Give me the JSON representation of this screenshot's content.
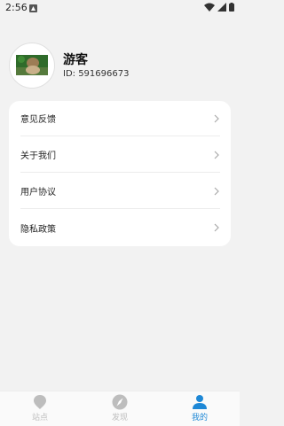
{
  "status_bar": {
    "time": "2:56"
  },
  "profile": {
    "username": "游客",
    "user_id": "ID: 591696673"
  },
  "menu": {
    "items": [
      {
        "label": "意见反馈"
      },
      {
        "label": "关于我们"
      },
      {
        "label": "用户协议"
      },
      {
        "label": "隐私政策"
      }
    ]
  },
  "bottom_nav": {
    "tabs": [
      {
        "label": "站点",
        "icon": "location-pin-icon",
        "active": false
      },
      {
        "label": "发现",
        "icon": "compass-icon",
        "active": false
      },
      {
        "label": "我的",
        "icon": "person-icon",
        "active": true
      }
    ]
  },
  "colors": {
    "accent": "#1e88d6",
    "inactive": "#bdbdbd",
    "background": "#f2f2f2"
  }
}
